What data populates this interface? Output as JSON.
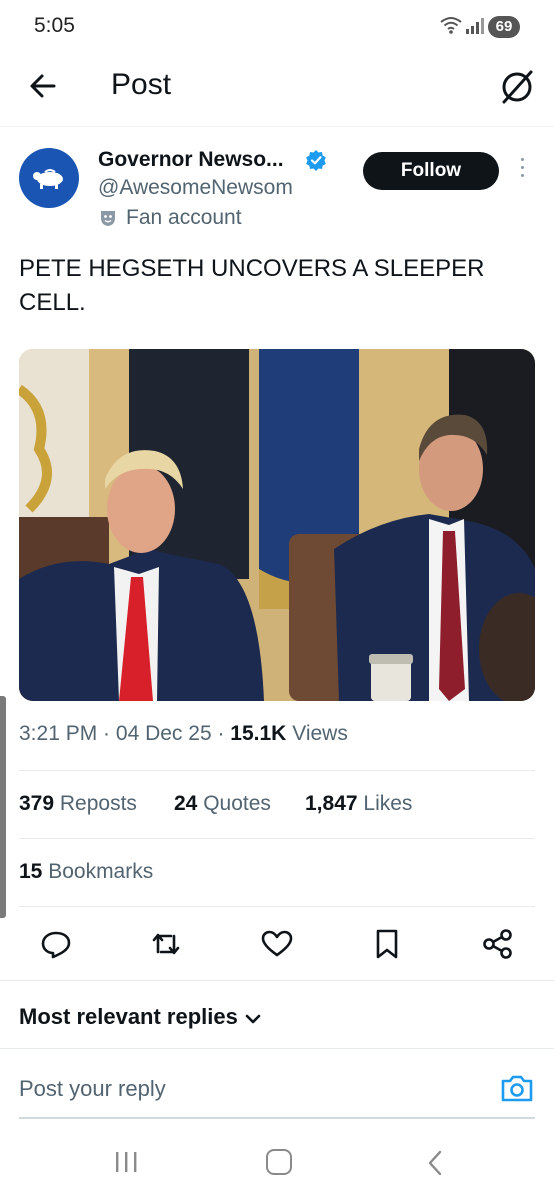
{
  "status_bar": {
    "time": "5:05",
    "battery": "69"
  },
  "header": {
    "title": "Post"
  },
  "author": {
    "name": "Governor Newso...",
    "handle": "@AwesomeNewsom",
    "label": "Fan account",
    "follow_label": "Follow"
  },
  "post": {
    "text": "PETE HEGSETH UNCOVERS A SLEEPER CELL.",
    "time": "3:21 PM",
    "date": "04 Dec 25",
    "views_count": "15.1K",
    "views_label": "Views"
  },
  "stats": {
    "reposts_count": "379",
    "reposts_label": "Reposts",
    "quotes_count": "24",
    "quotes_label": "Quotes",
    "likes_count": "1,847",
    "likes_label": "Likes",
    "bookmarks_count": "15",
    "bookmarks_label": "Bookmarks"
  },
  "replies": {
    "sort_label": "Most relevant replies",
    "placeholder": "Post your reply"
  },
  "icons": [
    "wifi-icon",
    "signal-icon",
    "back-arrow-icon",
    "grok-icon",
    "verified-badge-icon",
    "fan-account-icon",
    "more-icon",
    "reply-icon",
    "repost-icon",
    "like-icon",
    "bookmark-icon",
    "share-icon",
    "chevron-down-icon",
    "camera-icon",
    "nav-recents-icon",
    "nav-home-icon",
    "nav-back-icon"
  ],
  "colors": {
    "accent": "#1d9bf0",
    "follow_bg": "#0f1419",
    "text_secondary": "#536471"
  }
}
